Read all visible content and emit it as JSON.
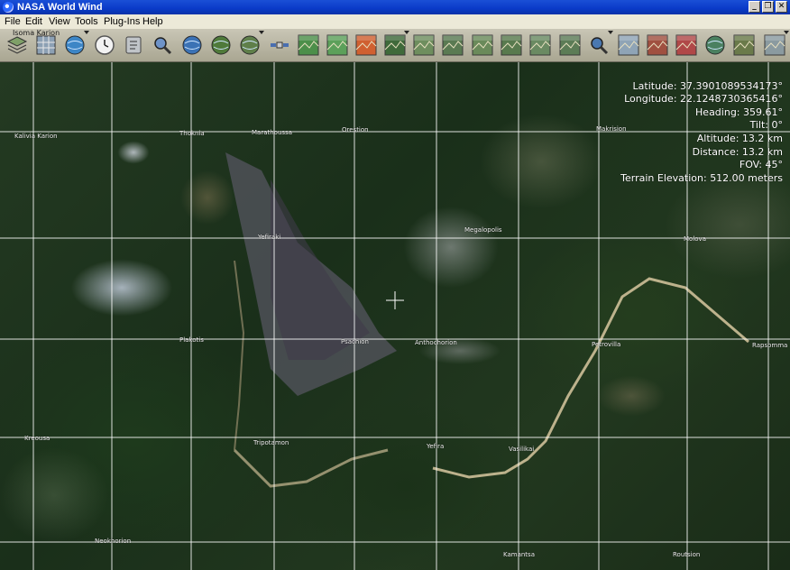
{
  "window": {
    "title": "NASA World Wind",
    "minimize_glyph": "_",
    "restore_glyph": "❐",
    "close_glyph": "✕"
  },
  "menu": {
    "items": [
      "File",
      "Edit",
      "View",
      "Tools",
      "Plug-Ins",
      "Help"
    ]
  },
  "toolbar": {
    "label": "Isoma Karion",
    "buttons": [
      {
        "icon": "layers-icon"
      },
      {
        "icon": "lat-lon-grid-icon"
      },
      {
        "icon": "globe-icon",
        "dropdown": true
      },
      {
        "icon": "clock-icon"
      },
      {
        "icon": "place-finder-icon"
      },
      {
        "icon": "search-icon"
      },
      {
        "icon": "blue-marble-icon"
      },
      {
        "icon": "landsat-globe-icon"
      },
      {
        "icon": "geocover-globe-icon",
        "dropdown": true
      },
      {
        "icon": "satellite-icon"
      },
      {
        "icon": "usgs-icon"
      },
      {
        "icon": "topo-map-icon"
      },
      {
        "icon": "heatmap-icon"
      },
      {
        "icon": "modis-icon",
        "dropdown": true
      },
      {
        "icon": "aerial-photo-icon-1"
      },
      {
        "icon": "aerial-photo-icon-2"
      },
      {
        "icon": "aerial-photo-icon-3"
      },
      {
        "icon": "aerial-photo-icon-4"
      },
      {
        "icon": "aerial-photo-icon-5"
      },
      {
        "icon": "aerial-photo-icon-6"
      },
      {
        "icon": "zoom-search-icon",
        "dropdown": true
      },
      {
        "icon": "terrain-icon"
      },
      {
        "icon": "boundaries-icon"
      },
      {
        "icon": "flag-icon"
      },
      {
        "icon": "compass-icon"
      },
      {
        "icon": "usa-map-icon"
      },
      {
        "icon": "screenshot-icon",
        "dropdown": true
      }
    ]
  },
  "position_info": {
    "latitude": "Latitude: 37.3901089534173°",
    "longitude": "Longitude: 22.1248730365416°",
    "heading": "Heading: 359.61°",
    "tilt": "Tilt: 0°",
    "altitude": "Altitude: 13.2 km",
    "distance": "Distance: 13.2 km",
    "fov": "FOV: 45°",
    "terrain": "Terrain Elevation: 512.00 meters"
  },
  "places": [
    "Kalivia Karion",
    "Thoknia",
    "Marathoussa",
    "Orestion",
    "Makrision",
    "Yefiraki",
    "Megalopolis",
    "Molova",
    "Plakotis",
    "Psachion",
    "Anthochorion",
    "Petrovilla",
    "Rapsomma",
    "Kreousa",
    "Tripotamon",
    "Yefira",
    "Vasilikai",
    "Neokhorion",
    "Kamantsa",
    "Routsion"
  ],
  "colors": {
    "titlebar": "#0a3ac8",
    "menubar": "#ece9d8",
    "grid_lines": "#ffffff"
  }
}
